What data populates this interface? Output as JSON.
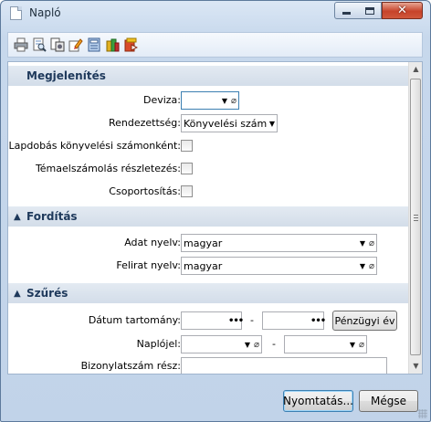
{
  "window": {
    "title": "Napló"
  },
  "toolbar": {
    "icons": [
      "printer-icon",
      "print-preview-icon",
      "print-setup-icon",
      "edit-icon",
      "calculator-icon",
      "report-icon",
      "export-icon"
    ]
  },
  "sections": {
    "display": {
      "title": "Megjelenítés"
    },
    "translation": {
      "title": "Fordítás"
    },
    "filter": {
      "title": "Szűrés"
    }
  },
  "fields": {
    "currency": {
      "label": "Deviza:",
      "value": ""
    },
    "ordering": {
      "label": "Rendezettség:",
      "value": "Könyvelési szám"
    },
    "page_break": {
      "label": "Lapdobás könyvelési számonként:",
      "checked": false
    },
    "topic_detail": {
      "label": "Témaelszámolás részletezés:",
      "checked": false
    },
    "grouping": {
      "label": "Csoportosítás:",
      "checked": false
    },
    "data_language": {
      "label": "Adat nyelv:",
      "value": "magyar"
    },
    "caption_language": {
      "label": "Felirat nyelv:",
      "value": "magyar"
    },
    "date_range": {
      "label": "Dátum tartomány:",
      "from": "",
      "to": "",
      "separator": "-",
      "button": "Pénzügyi év"
    },
    "journal": {
      "label": "Naplójel:",
      "from": "",
      "to": "",
      "separator": "-"
    },
    "voucher": {
      "label": "Bizonylatszám rész:",
      "value": ""
    }
  },
  "footer": {
    "print_label": "Nyomtatás...",
    "cancel_label": "Mégse"
  }
}
